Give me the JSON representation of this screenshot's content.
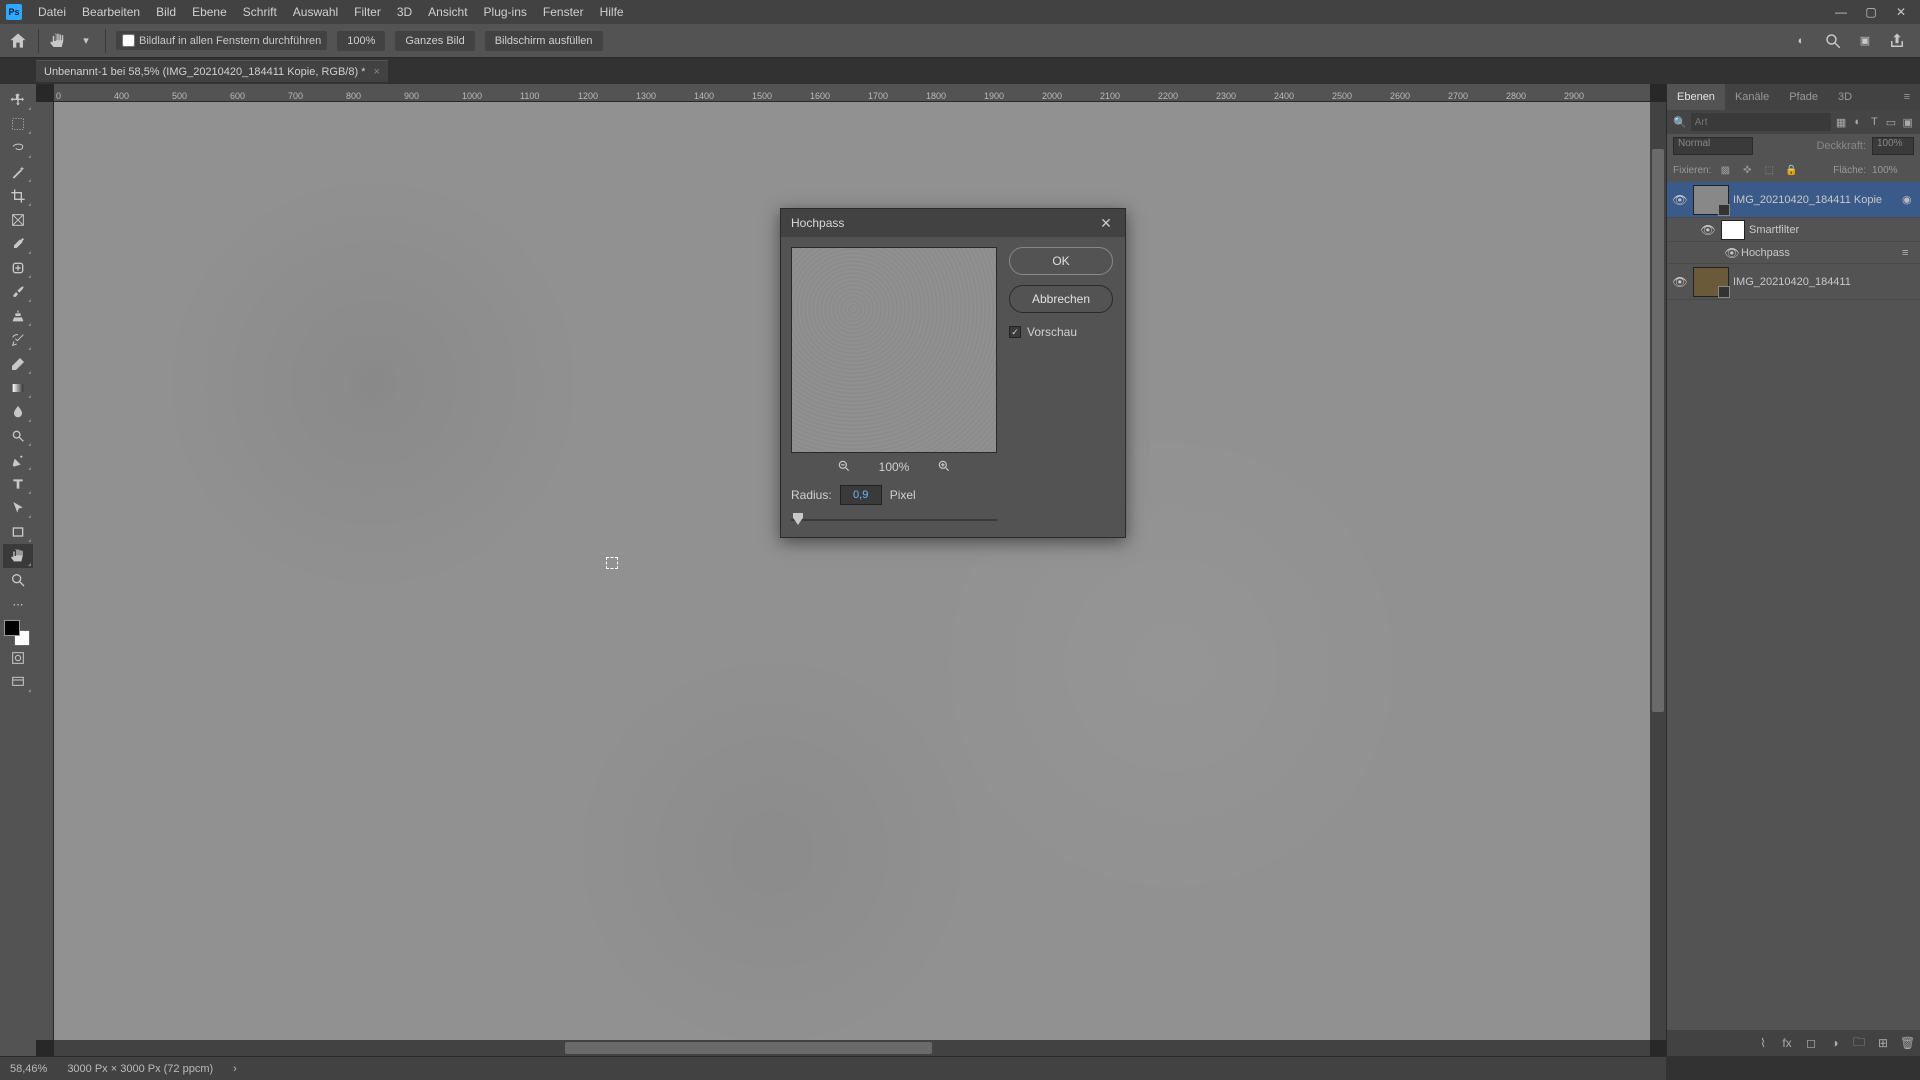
{
  "app_logo_text": "Ps",
  "menu": [
    "Datei",
    "Bearbeiten",
    "Bild",
    "Ebene",
    "Schrift",
    "Auswahl",
    "Filter",
    "3D",
    "Ansicht",
    "Plug-ins",
    "Fenster",
    "Hilfe"
  ],
  "options": {
    "scroll_all_windows": "Bildlauf in allen Fenstern durchführen",
    "zoom_100": "100%",
    "fit_screen": "Ganzes Bild",
    "fill_screen": "Bildschirm ausfüllen"
  },
  "doc_tab": "Unbenannt-1 bei 58,5% (IMG_20210420_184411 Kopie, RGB/8) *",
  "ruler_ticks": [
    "0",
    "400",
    "500",
    "600",
    "700",
    "800",
    "900",
    "1000",
    "1100",
    "1200",
    "1300",
    "1400",
    "1500",
    "1600",
    "1700",
    "1800",
    "1900",
    "2000",
    "2100",
    "2200",
    "2300",
    "2400",
    "2500",
    "2600",
    "2700",
    "2800",
    "2900"
  ],
  "panel_tabs": [
    "Ebenen",
    "Kanäle",
    "Pfade",
    "3D"
  ],
  "filter_placeholder": "Art",
  "blend": {
    "mode": "Normal",
    "opacity_label": "Deckkraft:",
    "opacity": "100%"
  },
  "locks": {
    "label": "Fixieren:",
    "fill_label": "Fläche:",
    "fill": "100%"
  },
  "layers": [
    {
      "name": "IMG_20210420_184411 Kopie",
      "smart": true,
      "selected": true
    },
    {
      "name": "Smartfilter",
      "sub": true,
      "mask": true
    },
    {
      "name": "Hochpass",
      "sub": true,
      "filter": true
    },
    {
      "name": "IMG_20210420_184411",
      "smart": true
    }
  ],
  "status": {
    "zoom": "58,46%",
    "doc": "3000 Px × 3000 Px (72 ppcm)"
  },
  "dialog": {
    "title": "Hochpass",
    "ok": "OK",
    "cancel": "Abbrechen",
    "preview": "Vorschau",
    "zoom": "100%",
    "radius_label": "Radius:",
    "radius_value": "0,9",
    "radius_unit": "Pixel"
  }
}
